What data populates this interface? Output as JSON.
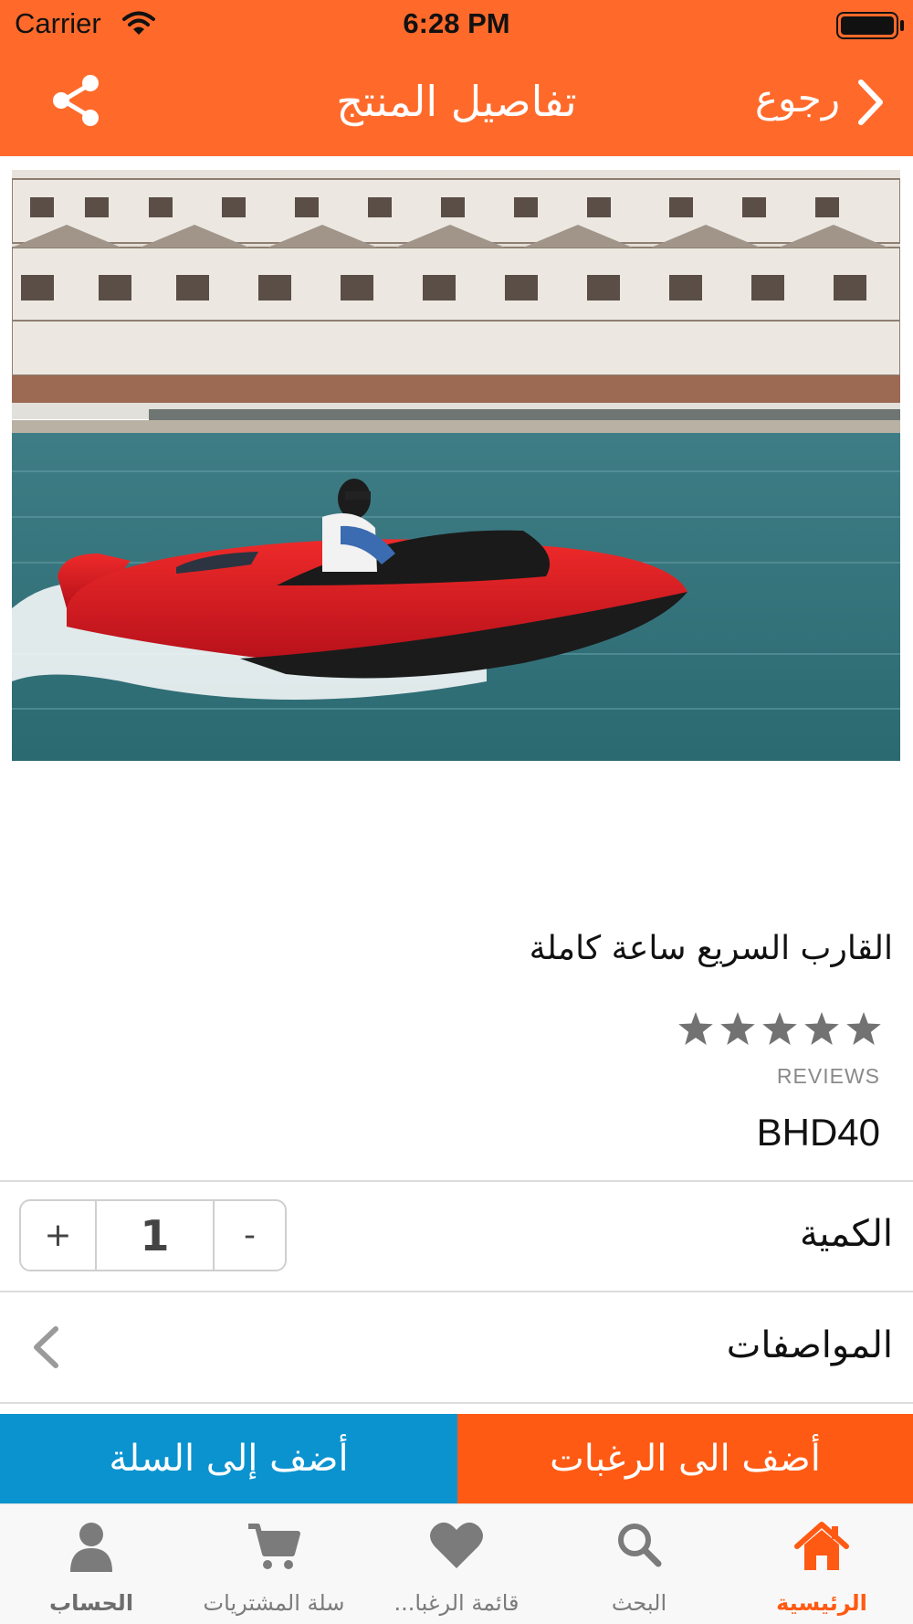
{
  "status_bar": {
    "carrier": "Carrier",
    "time": "6:28 PM"
  },
  "nav": {
    "title": "تفاصيل المنتج",
    "back_label": "رجوع"
  },
  "product": {
    "name": "القارب السريع ساعة كاملة",
    "rating_stars": 5,
    "reviews_label": "REVIEWS",
    "price": "BHD40"
  },
  "quantity": {
    "label": "الكمية",
    "value": "1",
    "plus": "+",
    "minus": "-"
  },
  "specs": {
    "label": "المواصفات"
  },
  "actions": {
    "add_to_wishlist": "أضف الى الرغبات",
    "add_to_cart": "أضف إلى السلة"
  },
  "tabs": [
    {
      "label": "الرئيسية",
      "icon": "home-icon",
      "active": true
    },
    {
      "label": "البحث",
      "icon": "search-icon",
      "active": false
    },
    {
      "label": "قائمة الرغبا...",
      "icon": "heart-icon",
      "active": false
    },
    {
      "label": "سلة المشتريات",
      "icon": "cart-icon",
      "active": false
    },
    {
      "label": "الحساب",
      "icon": "person-icon",
      "active": false
    }
  ],
  "colors": {
    "header": "#ff6a2b",
    "wishlist_button": "#ff5a14",
    "cart_button": "#0a93cf",
    "active_tab": "#ff5a14",
    "inactive_tab": "#7b7b7b"
  }
}
